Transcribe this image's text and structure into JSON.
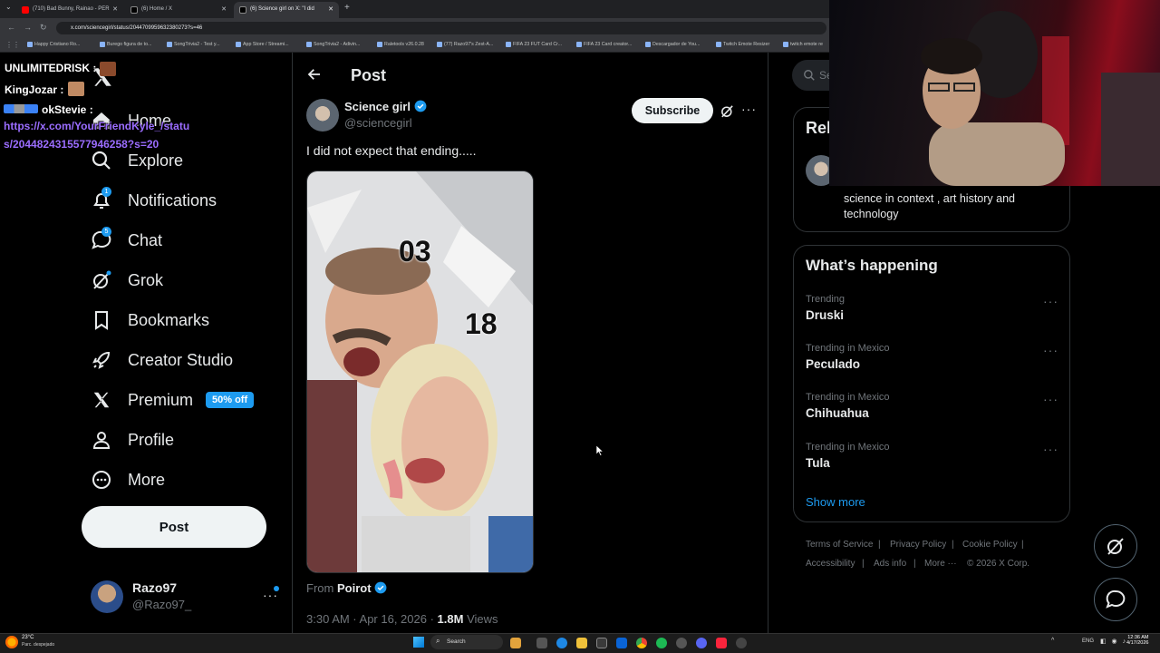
{
  "browser": {
    "tabs": [
      {
        "title": "(710) Bad Bunny, Rainao - PER"
      },
      {
        "title": "(6) Home / X"
      },
      {
        "title": "(6) Science girl on X: \"I did"
      }
    ],
    "url": "x.com/sciencegirl/status/2044709959632380273?s=46",
    "bookmarks": [
      "Happy Cristiano Ro...",
      "Burego figura de to...",
      "SongTrivia2 - Test y...",
      "App Store / Streami...",
      "SongTrivia2 - Adivin...",
      "Raletools v26.0.28",
      "(77) Razo97's Zest-A...",
      "FIFA 23 FUT Card Cr...",
      "FIFA 23 Card creator...",
      "Descargador de You...",
      "Twitch Emote Resizer",
      "twitch emote re"
    ]
  },
  "stream_chat": [
    {
      "user": "UNLIMITEDRISK :",
      "text": ""
    },
    {
      "user": "KingJozar :",
      "text": ""
    },
    {
      "user": "okStevie :",
      "text": ""
    },
    {
      "user": "",
      "text": "https://x.com/YourFriendKyle_/statu"
    },
    {
      "user": "",
      "text": "s/2044824315577946258?s=20"
    }
  ],
  "nav": {
    "items": [
      {
        "label": "Home",
        "icon": "home-icon"
      },
      {
        "label": "Explore",
        "icon": "search-icon"
      },
      {
        "label": "Notifications",
        "icon": "bell-icon",
        "badge": "1"
      },
      {
        "label": "Chat",
        "icon": "chat-icon",
        "badge": "5"
      },
      {
        "label": "Grok",
        "icon": "grok-icon"
      },
      {
        "label": "Bookmarks",
        "icon": "bookmark-icon"
      },
      {
        "label": "Creator Studio",
        "icon": "rocket-icon"
      },
      {
        "label": "Premium",
        "icon": "x-logo-icon",
        "badge": "50% off"
      },
      {
        "label": "Profile",
        "icon": "person-icon"
      },
      {
        "label": "More",
        "icon": "more-circle-icon"
      }
    ],
    "post_button": "Post",
    "account": {
      "name": "Razo97",
      "handle": "@Razo97_"
    }
  },
  "post": {
    "header_title": "Post",
    "author_name": "Science girl",
    "author_handle": "@sciencegirl",
    "subscribe_label": "Subscribe",
    "text": "I did not expect that ending.....",
    "overlay_numbers": [
      "03",
      "18"
    ],
    "from_label": "From",
    "from_name": "Poirot",
    "timestamp": "3:30 AM · Apr 16, 2026 ·",
    "views_count": "1.8M",
    "views_label": "Views"
  },
  "sidebar": {
    "search_placeholder": "Se",
    "relevant_heading": "Rel",
    "relevant_bio": "science in context , art history and technology",
    "whats_happening": "What’s happening",
    "trends": [
      {
        "context": "Trending",
        "name": "Druski"
      },
      {
        "context": "Trending in Mexico",
        "name": "Peculado"
      },
      {
        "context": "Trending in Mexico",
        "name": "Chihuahua"
      },
      {
        "context": "Trending in Mexico",
        "name": "Tula"
      }
    ],
    "show_more": "Show more",
    "footer": [
      "Terms of Service",
      "Privacy Policy",
      "Cookie Policy",
      "Accessibility",
      "Ads info",
      "More ···",
      "© 2026 X Corp."
    ]
  },
  "taskbar": {
    "weather_temp": "23°C",
    "weather_desc": "Parc. despejado",
    "search_label": "Search",
    "lang": "ENG",
    "time": "12:36 AM",
    "date": "4/17/2026"
  },
  "colors": {
    "accent": "#1d9bf0",
    "background": "#000000",
    "border": "#2f3336",
    "muted": "#71767b"
  }
}
